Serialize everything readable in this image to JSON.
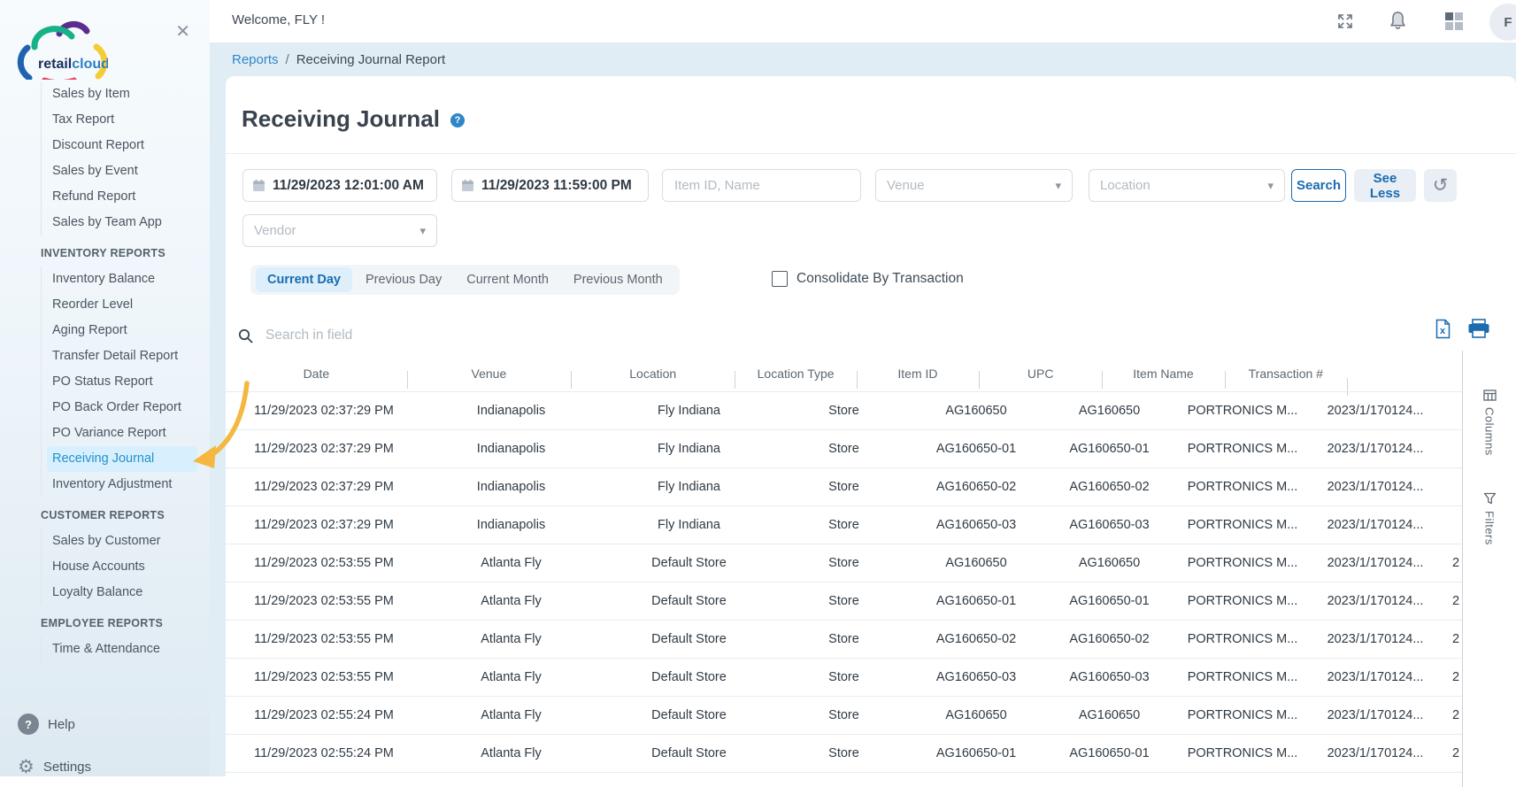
{
  "header": {
    "welcome": "Welcome, FLY !",
    "avatar_initial": "F"
  },
  "breadcrumb": {
    "parent": "Reports",
    "separator": "/",
    "current": "Receiving Journal Report"
  },
  "sidebar": {
    "logo_text_1": "retail",
    "logo_text_2": "cloud",
    "active_item": "Receiving Journal",
    "sections": [
      {
        "header": "",
        "items": [
          "Sales by Item",
          "Tax Report",
          "Discount Report",
          "Sales by Event",
          "Refund Report",
          "Sales by Team App"
        ]
      },
      {
        "header": "INVENTORY REPORTS",
        "items": [
          "Inventory Balance",
          "Reorder Level",
          "Aging Report",
          "Transfer Detail Report",
          "PO Status Report",
          "PO Back Order Report",
          "PO Variance Report",
          "Receiving Journal",
          "Inventory Adjustment"
        ]
      },
      {
        "header": "CUSTOMER REPORTS",
        "items": [
          "Sales by Customer",
          "House Accounts",
          "Loyalty Balance"
        ]
      },
      {
        "header": "EMPLOYEE REPORTS",
        "items": [
          "Time & Attendance"
        ]
      }
    ],
    "help_label": "Help",
    "settings_label": "Settings"
  },
  "page": {
    "title": "Receiving Journal"
  },
  "filters": {
    "start_datetime": "11/29/2023 12:01:00 AM",
    "end_datetime": "11/29/2023 11:59:00 PM",
    "item_placeholder": "Item ID, Name",
    "venue_placeholder": "Venue",
    "location_placeholder": "Location",
    "vendor_placeholder": "Vendor",
    "search_label": "Search",
    "see_less_label": "See Less",
    "reset_glyph": "↺"
  },
  "tabs": {
    "items": [
      "Current Day",
      "Previous Day",
      "Current Month",
      "Previous Month"
    ],
    "active": "Current Day"
  },
  "options": {
    "consolidate_label": "Consolidate By Transaction",
    "checked": false
  },
  "table_toolbar": {
    "search_placeholder": "Search in field"
  },
  "table": {
    "columns": [
      "Date",
      "Venue",
      "Location",
      "Location Type",
      "Item ID",
      "UPC",
      "Item Name",
      "Transaction #"
    ],
    "rows": [
      [
        "11/29/2023 02:37:29 PM",
        "Indianapolis",
        "Fly Indiana",
        "Store",
        "AG160650",
        "AG160650",
        "PORTRONICS M...",
        "2023/1/170124...",
        ""
      ],
      [
        "11/29/2023 02:37:29 PM",
        "Indianapolis",
        "Fly Indiana",
        "Store",
        "AG160650-01",
        "AG160650-01",
        "PORTRONICS M...",
        "2023/1/170124...",
        ""
      ],
      [
        "11/29/2023 02:37:29 PM",
        "Indianapolis",
        "Fly Indiana",
        "Store",
        "AG160650-02",
        "AG160650-02",
        "PORTRONICS M...",
        "2023/1/170124...",
        ""
      ],
      [
        "11/29/2023 02:37:29 PM",
        "Indianapolis",
        "Fly Indiana",
        "Store",
        "AG160650-03",
        "AG160650-03",
        "PORTRONICS M...",
        "2023/1/170124...",
        ""
      ],
      [
        "11/29/2023 02:53:55 PM",
        "Atlanta Fly",
        "Default Store",
        "Store",
        "AG160650",
        "AG160650",
        "PORTRONICS M...",
        "2023/1/170124...",
        "2"
      ],
      [
        "11/29/2023 02:53:55 PM",
        "Atlanta Fly",
        "Default Store",
        "Store",
        "AG160650-01",
        "AG160650-01",
        "PORTRONICS M...",
        "2023/1/170124...",
        "2"
      ],
      [
        "11/29/2023 02:53:55 PM",
        "Atlanta Fly",
        "Default Store",
        "Store",
        "AG160650-02",
        "AG160650-02",
        "PORTRONICS M...",
        "2023/1/170124...",
        "2"
      ],
      [
        "11/29/2023 02:53:55 PM",
        "Atlanta Fly",
        "Default Store",
        "Store",
        "AG160650-03",
        "AG160650-03",
        "PORTRONICS M...",
        "2023/1/170124...",
        "2"
      ],
      [
        "11/29/2023 02:55:24 PM",
        "Atlanta Fly",
        "Default Store",
        "Store",
        "AG160650",
        "AG160650",
        "PORTRONICS M...",
        "2023/1/170124...",
        "2"
      ],
      [
        "11/29/2023 02:55:24 PM",
        "Atlanta Fly",
        "Default Store",
        "Store",
        "AG160650-01",
        "AG160650-01",
        "PORTRONICS M...",
        "2023/1/170124...",
        "2"
      ]
    ]
  },
  "side_panel": {
    "columns_label": "Columns",
    "filters_label": "Filters"
  },
  "colors": {
    "accent_blue": "#1a6cb0",
    "link_blue": "#2e86c8",
    "active_item_bg": "#d8f0fd",
    "annotation_arrow": "#F4B73F"
  }
}
